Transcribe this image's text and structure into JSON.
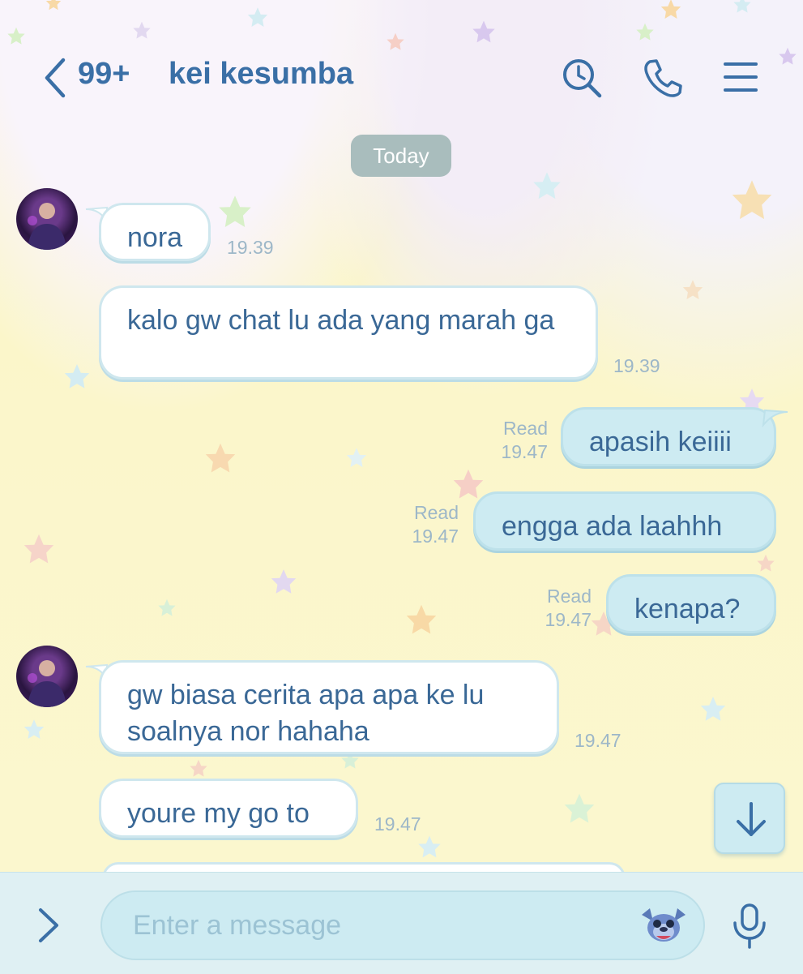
{
  "header": {
    "back_icon": "chevron-left-icon",
    "unread_count": "99+",
    "contact_name": "kei kesumba",
    "icons": [
      "history-search-icon",
      "phone-icon",
      "menu-icon"
    ]
  },
  "date_separator": "Today",
  "messages": [
    {
      "side": "in",
      "text": "nora",
      "time": "19.39",
      "avatar": true
    },
    {
      "side": "in",
      "text": "kalo gw chat lu ada yang marah ga",
      "time": "19.39",
      "avatar": false
    },
    {
      "side": "out",
      "text": "apasih keiiii",
      "status": "Read",
      "time": "19.47"
    },
    {
      "side": "out",
      "text": "engga ada laahhh",
      "status": "Read",
      "time": "19.47"
    },
    {
      "side": "out",
      "text": "kenapa?",
      "status": "Read",
      "time": "19.47"
    },
    {
      "side": "in",
      "text": "gw biasa cerita apa apa ke lu soalnya nor hahaha",
      "time": "19.47",
      "avatar": true
    },
    {
      "side": "in",
      "text": "youre my go to",
      "time": "19.47",
      "avatar": false
    }
  ],
  "composer": {
    "placeholder": "Enter a message",
    "expand_icon": "chevron-right-icon",
    "sticker_icon": "stitch-sticker-icon",
    "mic_icon": "microphone-icon"
  },
  "scroll_down_icon": "arrow-down-icon",
  "colors": {
    "accent": "#3a6fa6",
    "background": "#fbf7cf",
    "incoming_bubble": "#ffffff",
    "outgoing_bubble": "#cdebf2",
    "timestamp": "#9db7c8"
  }
}
